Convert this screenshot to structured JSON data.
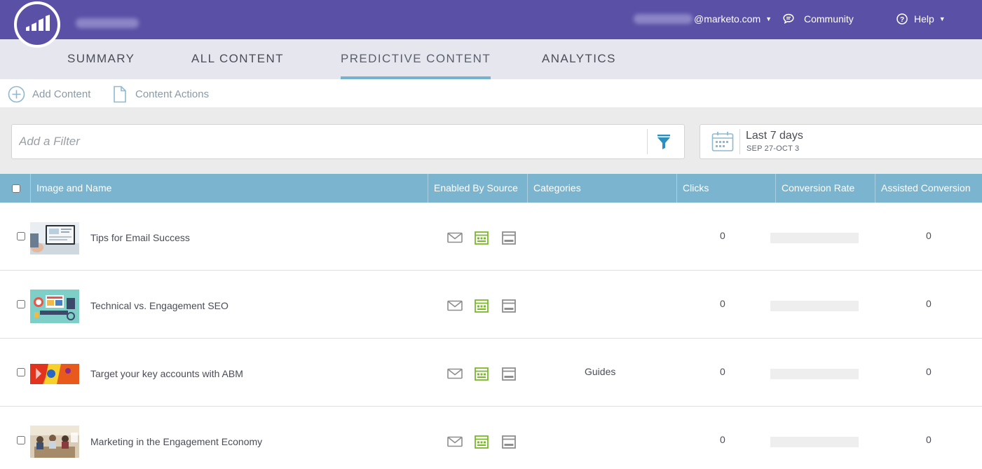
{
  "header": {
    "user_email_suffix": "@marketo.com",
    "community_label": "Community",
    "help_label": "Help"
  },
  "nav": {
    "tabs": [
      {
        "label": "SUMMARY"
      },
      {
        "label": "ALL CONTENT"
      },
      {
        "label": "PREDICTIVE CONTENT",
        "active": true
      },
      {
        "label": "ANALYTICS"
      }
    ]
  },
  "actions": {
    "add_content": "Add Content",
    "content_actions": "Content Actions"
  },
  "filter": {
    "placeholder": "Add a Filter"
  },
  "date_range": {
    "label": "Last 7 days",
    "range": "SEP 27-OCT 3"
  },
  "table": {
    "columns": [
      "Image and Name",
      "Enabled By Source",
      "Categories",
      "Clicks",
      "Conversion Rate",
      "Assisted Conversion"
    ],
    "rows": [
      {
        "name": "Tips for Email Success",
        "thumbnail": "computer-desk-image",
        "category": "",
        "clicks": "0",
        "assisted": "0"
      },
      {
        "name": "Technical vs. Engagement SEO",
        "thumbnail": "seo-illustration-image",
        "category": "",
        "clicks": "0",
        "assisted": "0"
      },
      {
        "name": "Target your key accounts with ABM",
        "thumbnail": "abstract-colorful-image",
        "category": "Guides",
        "clicks": "0",
        "assisted": "0"
      },
      {
        "name": "Marketing in the Engagement Economy",
        "thumbnail": "office-meeting-image",
        "category": "",
        "clicks": "0",
        "assisted": "0"
      }
    ]
  },
  "colors": {
    "header_bg": "#5a51a6",
    "nav_bg": "#e6e6ee",
    "table_header_bg": "#7bb4cf",
    "active_tab_underline": "#74b3cf",
    "enabled_icon": "#7ab82a",
    "disabled_icon": "#8e8e8e"
  }
}
